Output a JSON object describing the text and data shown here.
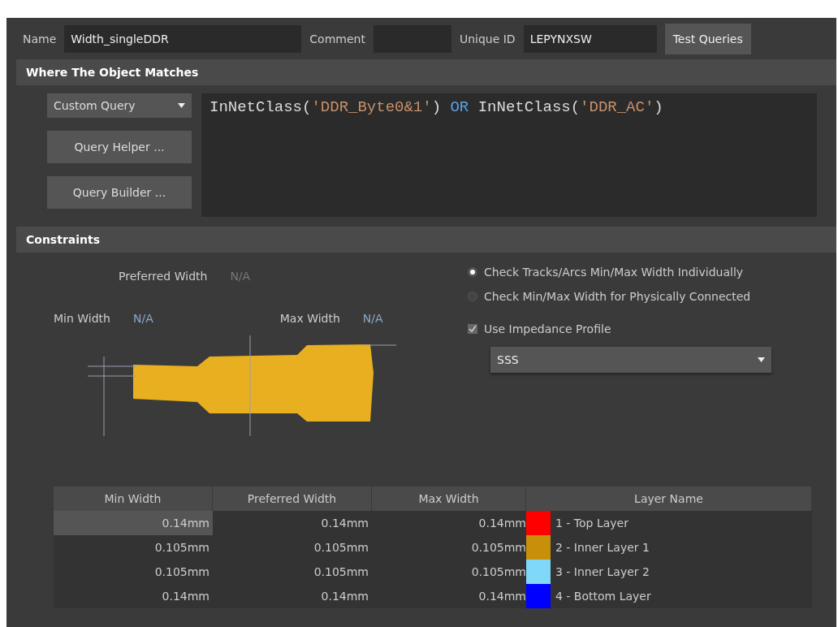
{
  "header": {
    "name_label": "Name",
    "name_value": "Width_singleDDR",
    "comment_label": "Comment",
    "uid_label": "Unique ID",
    "uid_value": "LEPYNXSW",
    "test_button": "Test Queries"
  },
  "where": {
    "title": "Where The Object Matches",
    "query_type": "Custom Query",
    "buttons": [
      "Query Helper ...",
      "Query Builder ..."
    ],
    "query": [
      {
        "kind": "func",
        "text": "InNetClass("
      },
      {
        "kind": "string",
        "text": "'DDR_Byte0&1'"
      },
      {
        "kind": "func",
        "text": ") "
      },
      {
        "kind": "keyword",
        "text": "OR"
      },
      {
        "kind": "func",
        "text": " InNetClass("
      },
      {
        "kind": "string",
        "text": "'DDR_AC'"
      },
      {
        "kind": "func",
        "text": ")"
      }
    ]
  },
  "constraints": {
    "title": "Constraints",
    "preferred_label": "Preferred Width",
    "preferred_value": "N/A",
    "min_label": "Min Width",
    "min_value": "N/A",
    "max_label": "Max Width",
    "max_value": "N/A",
    "options": [
      {
        "label": "Check Tracks/Arcs Min/Max Width Individually",
        "selected": true
      },
      {
        "label": "Check Min/Max Width for Physically Connected",
        "selected": false
      }
    ],
    "impedance": {
      "label": "Use Impedance Profile",
      "checked": true,
      "profile": "SSS"
    },
    "table": {
      "columns": [
        "Min Width",
        "Preferred Width",
        "Max Width",
        "Layer Name"
      ],
      "rows": [
        {
          "min": "0.14mm",
          "preferred": "0.14mm",
          "max": "0.14mm",
          "layer": "1 - Top Layer",
          "color": "#ff0000",
          "selected": true
        },
        {
          "min": "0.105mm",
          "preferred": "0.105mm",
          "max": "0.105mm",
          "layer": "2 - Inner Layer 1",
          "color": "#c8900a",
          "selected": false
        },
        {
          "min": "0.105mm",
          "preferred": "0.105mm",
          "max": "0.105mm",
          "layer": "3 - Inner Layer 2",
          "color": "#80d8f8",
          "selected": false
        },
        {
          "min": "0.14mm",
          "preferred": "0.14mm",
          "max": "0.14mm",
          "layer": "4 - Bottom Layer",
          "color": "#0000ff",
          "selected": false
        }
      ]
    }
  }
}
